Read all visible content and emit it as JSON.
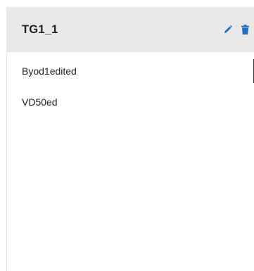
{
  "group": {
    "title": "TG1_1",
    "edit_icon": "pencil-icon",
    "delete_icon": "trash-icon",
    "icon_color": "#1a6fc4"
  },
  "items": [
    {
      "label": "Byod1edited"
    },
    {
      "label": "VD50ed"
    }
  ]
}
